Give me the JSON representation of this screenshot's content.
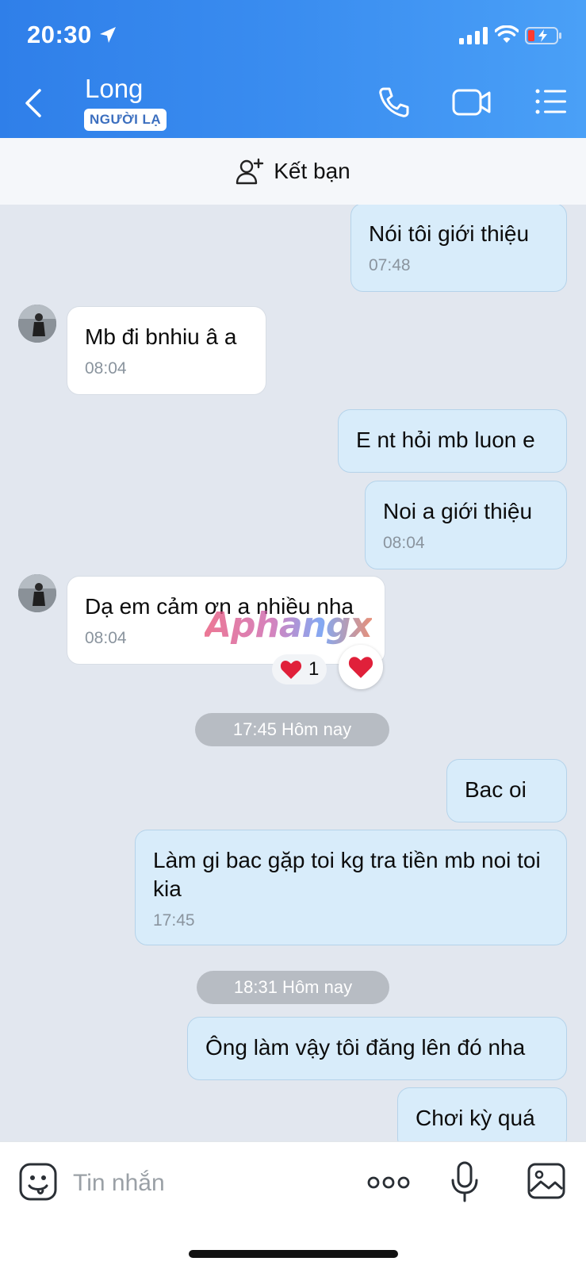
{
  "status_bar": {
    "time": "20:30"
  },
  "header": {
    "contact_name": "Long",
    "badge": "NGƯỜI LẠ"
  },
  "add_friend": {
    "label": "Kết bạn"
  },
  "messages": [
    {
      "text": "Nói tôi giới thiệu",
      "time": "07:48"
    },
    {
      "text": "Mb đi bnhiu â a",
      "time": "08:04"
    },
    {
      "text": "E nt hỏi mb luon e"
    },
    {
      "text": "Noi a giới thiệu",
      "time": "08:04"
    },
    {
      "text": "Dạ em cảm ơn a nhiều nha",
      "time": "08:04",
      "reaction_count": "1"
    },
    {
      "text": "Bac oi"
    },
    {
      "text": "Làm gi bac gặp toi kg tra tiền mb noi toi kia",
      "time": "17:45"
    },
    {
      "text": "Ông làm vậy tôi đăng lên đó nha"
    },
    {
      "text": "Chơi kỳ quá"
    }
  ],
  "separators": [
    "17:45 Hôm nay",
    "18:31 Hôm nay"
  ],
  "watermark": "Aphangx",
  "input": {
    "placeholder": "Tin nhắn"
  },
  "colors": {
    "header_start": "#2f7fe9",
    "header_end": "#4aa0f7",
    "outgoing_bubble": "#d8ecfa",
    "incoming_bubble": "#ffffff",
    "chat_background": "#e2e7ef"
  }
}
